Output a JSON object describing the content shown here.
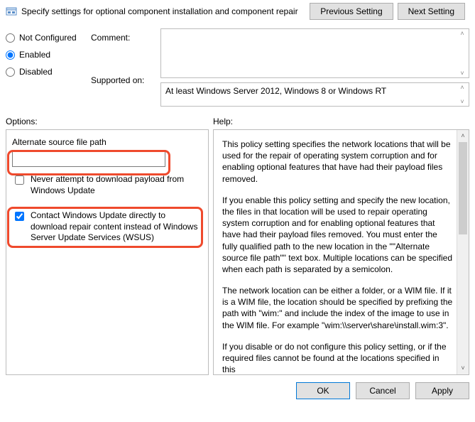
{
  "title": "Specify settings for optional component installation and component repair",
  "nav": {
    "prev": "Previous Setting",
    "next": "Next Setting"
  },
  "state": {
    "not_configured": "Not Configured",
    "enabled": "Enabled",
    "disabled": "Disabled",
    "selected": "enabled"
  },
  "labels": {
    "comment": "Comment:",
    "supported": "Supported on:",
    "options": "Options:",
    "help": "Help:"
  },
  "supported_text": "At least Windows Server 2012, Windows 8 or Windows RT",
  "options": {
    "alt_path_label": "Alternate source file path",
    "alt_path_value": "",
    "never_download": {
      "label": "Never attempt to download payload from Windows Update",
      "checked": false
    },
    "contact_wu": {
      "label": "Contact Windows Update directly to download repair content instead of Windows Server Update Services (WSUS)",
      "checked": true
    }
  },
  "help": {
    "p1": "This policy setting specifies the network locations that will be used for the repair of operating system corruption and for enabling optional features that have had their payload files removed.",
    "p2": "If you enable this policy setting and specify the new location, the files in that location will be used to repair operating system corruption and for enabling optional features that have had their payload files removed. You must enter the fully qualified path to the new location in the \"\"Alternate source file path\"\" text box. Multiple locations can be specified when each path is separated by a semicolon.",
    "p3": "The network location can be either a folder, or a WIM file. If it is a WIM file, the location should be specified by prefixing the path with \"wim:\" and include the index of the image to use in the WIM file. For example \"wim:\\\\server\\share\\install.wim:3\".",
    "p4": "If you disable or do not configure this policy setting, or if the required files cannot be found at the locations specified in this"
  },
  "footer": {
    "ok": "OK",
    "cancel": "Cancel",
    "apply": "Apply"
  }
}
